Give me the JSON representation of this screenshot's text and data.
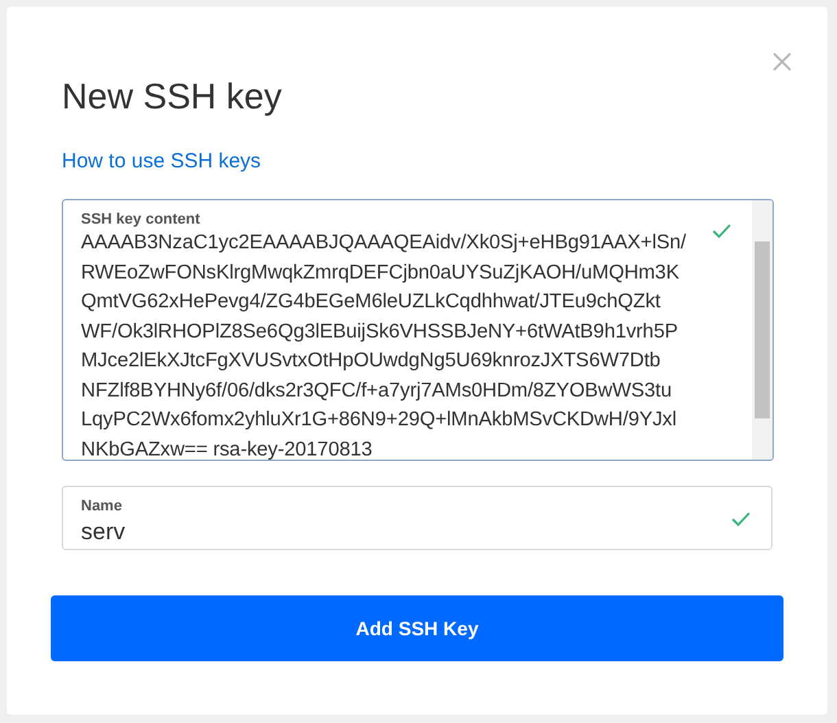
{
  "dialog": {
    "title": "New SSH key",
    "help_link": "How to use SSH keys",
    "fields": [
      {
        "kind": "textarea",
        "label": "SSH key content",
        "valid": true,
        "value_lines": [
          "AAAAB3NzaC1yc2EAAAABJQAAAQEAidv/Xk0Sj+eHBg91AAX+lSn/",
          "RWEoZwFONsKlrgMwqkZmrqDEFCjbn0aUYSuZjKAOH/uMQHm3K",
          "QmtVG62xHePevg4/ZG4bEGeM6leUZLkCqdhhwat/JTEu9chQZkt",
          "WF/Ok3lRHOPlZ8Se6Qg3lEBuijSk6VHSSBJeNY+6tWAtB9h1vrh5P",
          "MJce2lEkXJtcFgXVUSvtxOtHpOUwdgNg5U69knrozJXTS6W7Dtb",
          "NFZlf8BYHNy6f/06/dks2r3QFC/f+a7yrj7AMs0HDm/8ZYOBwWS3tu",
          "LqyPC2Wx6fomx2yhluXr1G+86N9+29Q+lMnAkbMSvCKDwH/9YJxl",
          "NKbGAZxw== rsa-key-20170813"
        ]
      },
      {
        "kind": "input",
        "label": "Name",
        "valid": true,
        "value": "serv"
      }
    ],
    "submit_button": "Add SSH Key"
  }
}
